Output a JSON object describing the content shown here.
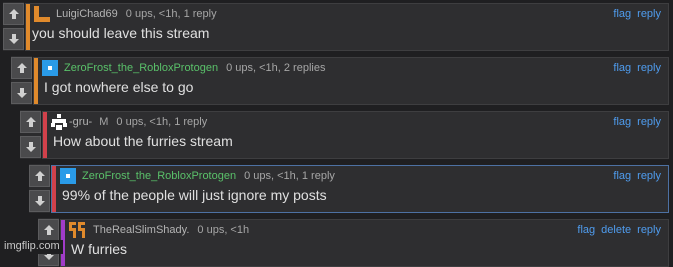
{
  "comments": [
    {
      "user": "LuigiChad69",
      "meta": "0 ups, <1h, 1 reply",
      "text": "you should leave this stream",
      "flag": "flag",
      "reply": "reply",
      "bar_color": "#e08a2c"
    },
    {
      "user": "ZeroFrost_the_RobloxProtogen",
      "meta": "0 ups, <1h, 2 replies",
      "text": "I got nowhere else to go",
      "flag": "flag",
      "reply": "reply",
      "bar_color": "#e08a2c",
      "name_color": "#5ac16a"
    },
    {
      "user": "-gru-",
      "mod": "M",
      "meta": "0 ups, <1h, 1 reply",
      "text": "How about the furries stream",
      "flag": "flag",
      "reply": "reply",
      "bar_color": "#d2414b"
    },
    {
      "user": "ZeroFrost_the_RobloxProtogen",
      "meta": "0 ups, <1h, 1 reply",
      "text": "99% of the people will just ignore my posts",
      "flag": "flag",
      "reply": "reply",
      "bar_color": "#d2414b",
      "name_color": "#5ac16a"
    },
    {
      "user": "TheRealSlimShady.",
      "meta": "0 ups, <1h",
      "text": "W furries",
      "flag": "flag",
      "delete": "delete",
      "reply": "reply",
      "bar_color": "#a13cc8"
    }
  ],
  "watermark": "imgflip.com",
  "icons": {
    "upvote": "arrow-up-icon",
    "downvote": "arrow-down-icon"
  }
}
